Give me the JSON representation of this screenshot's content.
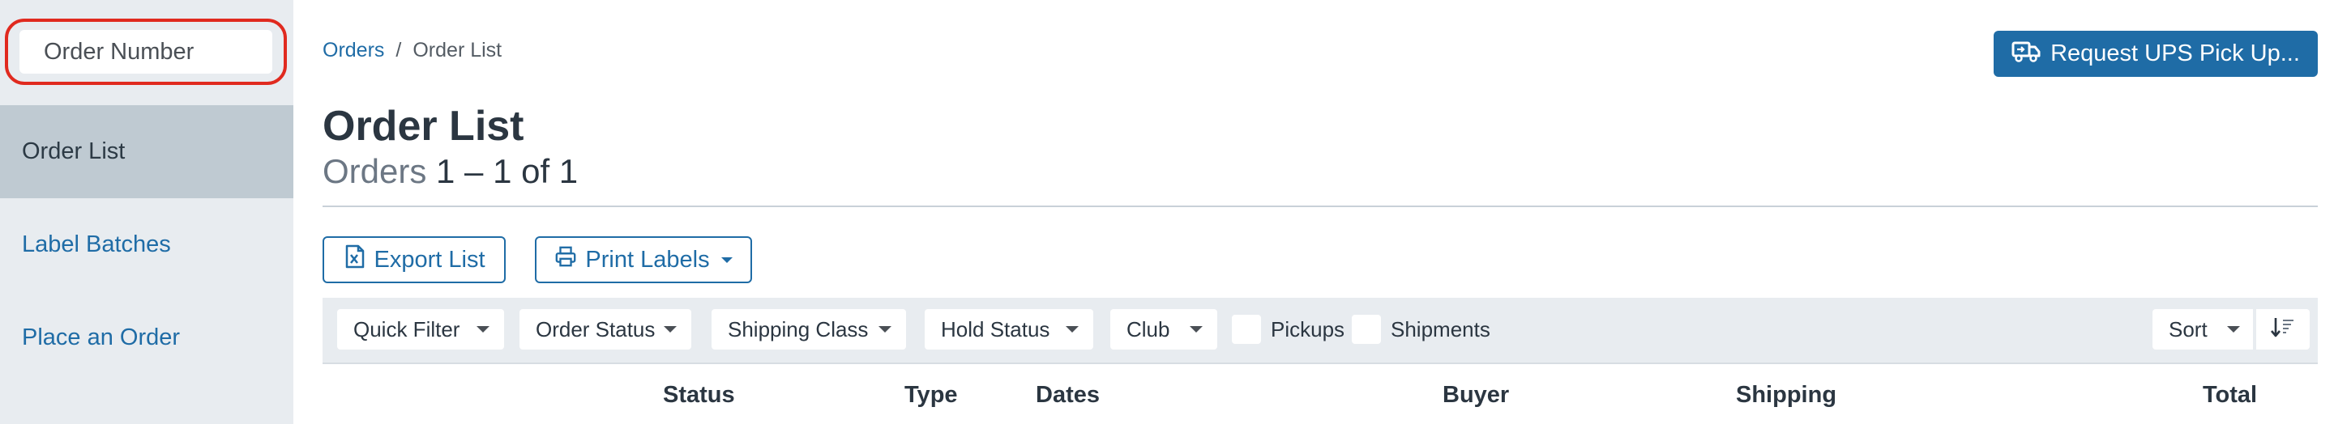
{
  "sidebar": {
    "search": {
      "placeholder": "Order Number"
    },
    "items": [
      {
        "label": "Order List",
        "active": true
      },
      {
        "label": "Label Batches",
        "active": false
      },
      {
        "label": "Place an Order",
        "active": false
      }
    ]
  },
  "breadcrumb": {
    "parent": "Orders",
    "separator": "/",
    "current": "Order List"
  },
  "header": {
    "ups_button_label": "Request UPS Pick Up...",
    "ups_button_icon": "truck-icon",
    "title": "Order List",
    "subtitle_prefix": "Orders",
    "subtitle_range": "1 – 1 of 1"
  },
  "actions": {
    "export_label": "Export List",
    "export_icon": "file-excel-icon",
    "print_label": "Print Labels",
    "print_icon": "printer-icon"
  },
  "filters": {
    "quick_filter": "Quick Filter",
    "order_status": "Order Status",
    "shipping_class": "Shipping Class",
    "hold_status": "Hold Status",
    "club": "Club",
    "pickups_label": "Pickups",
    "shipments_label": "Shipments",
    "sort_label": "Sort",
    "sort_direction_icon": "sort-descending-icon"
  },
  "table": {
    "columns": [
      "Status",
      "Type",
      "Dates",
      "Buyer",
      "Shipping",
      "Total"
    ]
  },
  "colors": {
    "accent": "#1f6ca6",
    "sidebar_bg": "#e8ecf0",
    "active_item_bg": "#bfcad2",
    "highlight_ring": "#e02a1f",
    "title_text": "#2b3641"
  }
}
